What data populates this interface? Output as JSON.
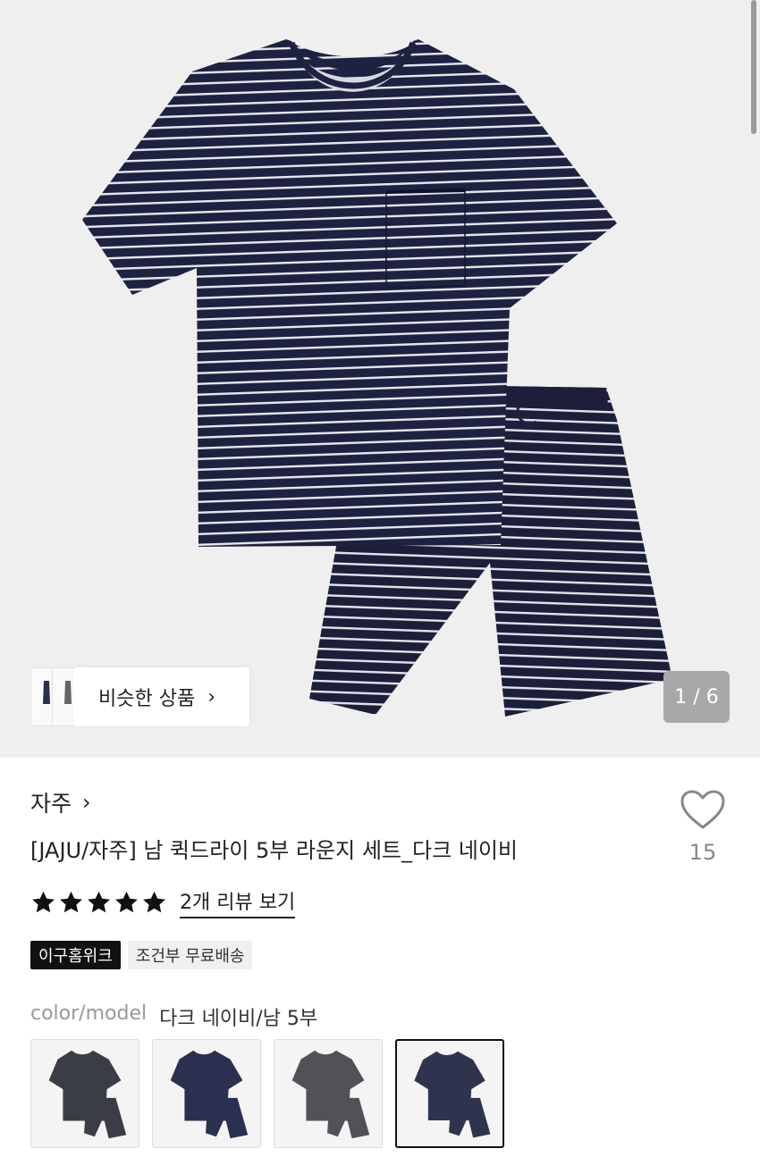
{
  "gallery": {
    "similar_label": "비슷한 상품",
    "similar_chevron": "›",
    "counter": "1 / 6"
  },
  "product": {
    "brand": "자주",
    "brand_chevron": "›",
    "title": "[JAJU/자주] 남 퀵드라이 5부 라운지 세트_다크 네이비",
    "like_count": "15",
    "rating": 5,
    "review_link": "2개 리뷰 보기",
    "badges": [
      "이구홈위크",
      "조건부 무료배송"
    ],
    "option_label": "color/model",
    "option_value": "다크 네이비/남 5부"
  },
  "swatches": [
    {
      "color": "#3a3d45",
      "selected": false
    },
    {
      "color": "#2a3050",
      "selected": false
    },
    {
      "color": "#505258",
      "selected": false
    },
    {
      "color": "#2e344e",
      "selected": true
    }
  ],
  "colors": {
    "navy": "#1d2240",
    "stripe": "#e8e8ee"
  },
  "icons": {
    "like": "heart-outline-icon",
    "star": "star-filled-icon"
  }
}
